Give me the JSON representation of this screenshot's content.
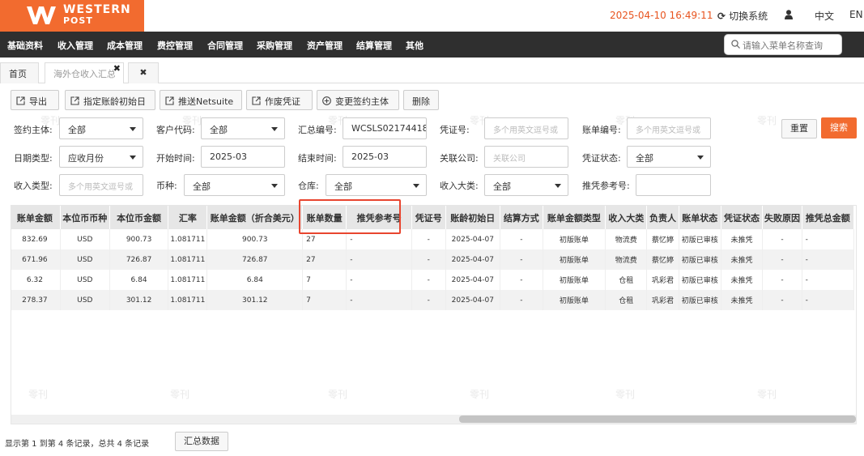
{
  "brand": {
    "line1": "WESTERN",
    "line2": "POST"
  },
  "header": {
    "datetime": "2025-04-10 16:49:11",
    "switch_system": "切换系统",
    "lang_zh": "中文",
    "lang_en": "EN"
  },
  "nav": {
    "items": [
      "基础资料",
      "收入管理",
      "成本管理",
      "费控管理",
      "合同管理",
      "采购管理",
      "资产管理",
      "结算管理",
      "其他"
    ],
    "search_placeholder": "请输入菜单名称查询"
  },
  "tabs": [
    {
      "label": "首页",
      "active": false
    },
    {
      "label": "海外仓收入汇总",
      "active": true
    },
    {
      "label": "",
      "active": false
    }
  ],
  "toolbar": {
    "export": "导出",
    "set_aging_start": "指定账龄初始日",
    "push_netsuite": "推送Netsuite",
    "void_voucher": "作废凭证",
    "change_entity": "变更签约主体",
    "delete": "删除"
  },
  "filters": {
    "contract_entity": {
      "label": "签约主体:",
      "value": "全部"
    },
    "customer_code": {
      "label": "客户代码:",
      "value": "全部"
    },
    "summary_no": {
      "label": "汇总编号:",
      "value": "WCSLS02174418"
    },
    "voucher_no": {
      "label": "凭证号:",
      "placeholder": "多个用英文逗号或"
    },
    "bill_no": {
      "label": "账单编号:",
      "placeholder": "多个用英文逗号或"
    },
    "date_type": {
      "label": "日期类型:",
      "value": "应收月份"
    },
    "start_time": {
      "label": "开始时间:",
      "value": "2025-03"
    },
    "end_time": {
      "label": "结束时间:",
      "value": "2025-03"
    },
    "related_company": {
      "label": "关联公司:",
      "placeholder": "关联公司"
    },
    "voucher_status": {
      "label": "凭证状态:",
      "value": "全部"
    },
    "income_type": {
      "label": "收入类型:",
      "placeholder": "多个用英文逗号或"
    },
    "currency": {
      "label": "币种:",
      "value": "全部"
    },
    "warehouse": {
      "label": "仓库:",
      "value": "全部"
    },
    "income_category": {
      "label": "收入大类:",
      "value": "全部"
    },
    "push_ref_no": {
      "label": "推凭参考号:",
      "value": ""
    }
  },
  "buttons": {
    "reset": "重置",
    "search": "搜索"
  },
  "table": {
    "columns": [
      "账单金额",
      "本位币币种",
      "本位币金额",
      "汇率",
      "账单金额（折合美元）",
      "账单数量",
      "推凭参考号",
      "凭证号",
      "账龄初始日",
      "结算方式",
      "账单金额类型",
      "收入大类",
      "负责人",
      "账单状态",
      "凭证状态",
      "失败原因",
      "推凭总金额"
    ],
    "rows": [
      [
        "832.69",
        "USD",
        "900.73",
        "1.081711",
        "900.73",
        "27",
        "-",
        "-",
        "2025-04-07",
        "-",
        "初版账单",
        "物流费",
        "蔡忆婷",
        "初版已审核",
        "未推凭",
        "-",
        "-"
      ],
      [
        "671.96",
        "USD",
        "726.87",
        "1.081711",
        "726.87",
        "27",
        "-",
        "-",
        "2025-04-07",
        "-",
        "初版账单",
        "物流费",
        "蔡忆婷",
        "初版已审核",
        "未推凭",
        "-",
        "-"
      ],
      [
        "6.32",
        "USD",
        "6.84",
        "1.081711",
        "6.84",
        "7",
        "-",
        "-",
        "2025-04-07",
        "-",
        "初版账单",
        "仓租",
        "巩彩君",
        "初版已审核",
        "未推凭",
        "-",
        "-"
      ],
      [
        "278.37",
        "USD",
        "301.12",
        "1.081711",
        "301.12",
        "7",
        "-",
        "-",
        "2025-04-07",
        "-",
        "初版账单",
        "仓租",
        "巩彩君",
        "初版已审核",
        "未推凭",
        "-",
        "-"
      ]
    ]
  },
  "footer": {
    "record_text": "显示第 1 到第 4 条记录，总共 4 条记录",
    "summary_button": "汇总数据"
  },
  "watermark": "零刊",
  "colors": {
    "brand_orange": "#f26b2f",
    "nav_bg": "#2f2f2f",
    "highlight_red": "#e8452f",
    "clock_red": "#e8541f"
  }
}
